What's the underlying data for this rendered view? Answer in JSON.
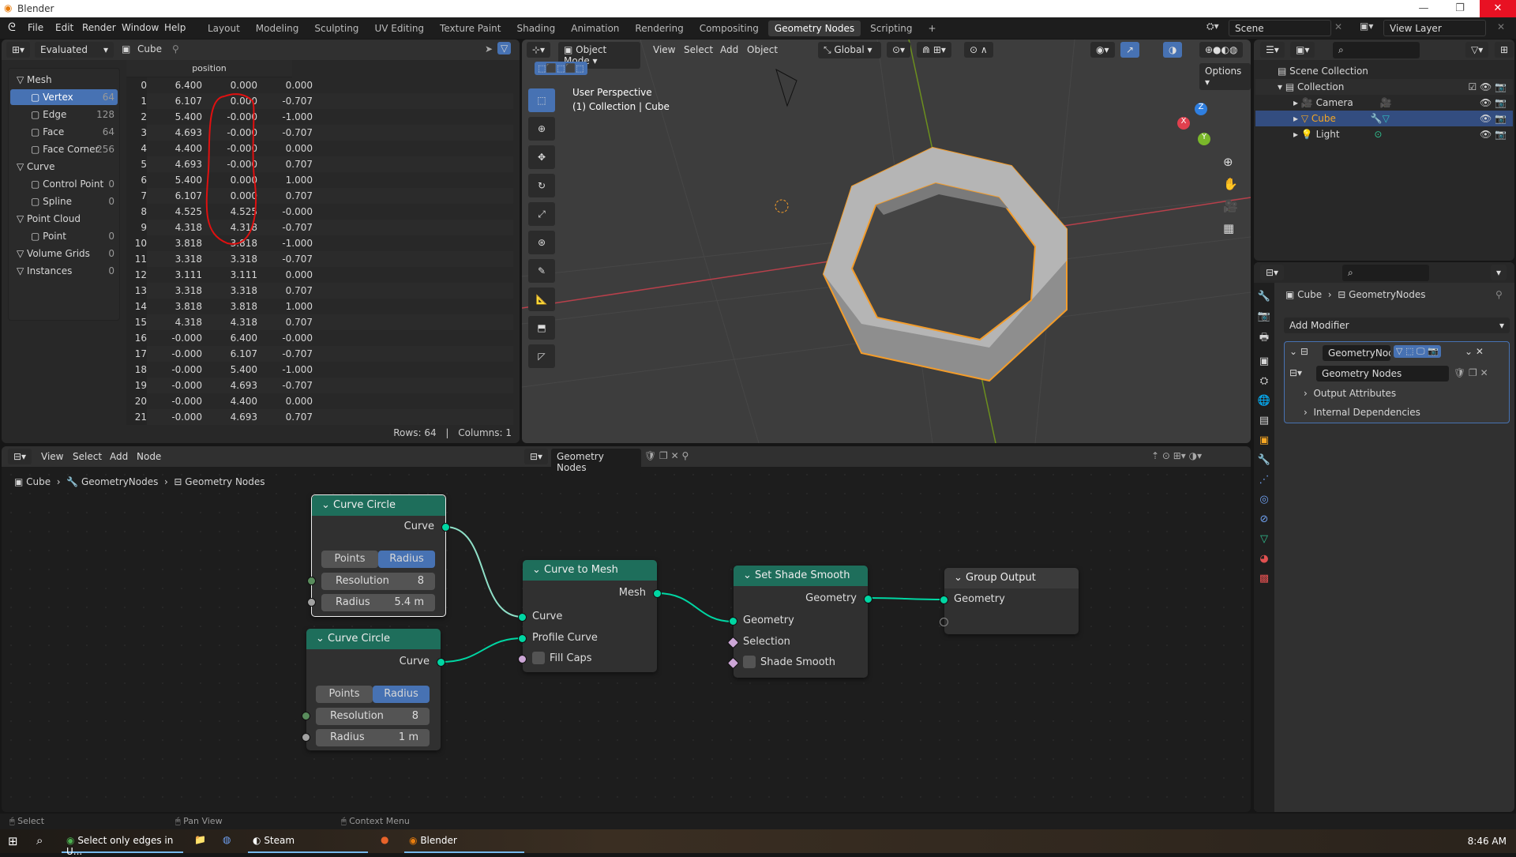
{
  "window": {
    "title": "Blender"
  },
  "menubar": {
    "items": [
      "File",
      "Edit",
      "Render",
      "Window",
      "Help"
    ],
    "workspaces": [
      "Layout",
      "Modeling",
      "Sculpting",
      "UV Editing",
      "Texture Paint",
      "Shading",
      "Animation",
      "Rendering",
      "Compositing",
      "Geometry Nodes",
      "Scripting"
    ],
    "active_workspace": "Geometry Nodes",
    "add_tab": "+",
    "scene": "Scene",
    "view_layer": "View Layer"
  },
  "spreadsheet": {
    "display_mode": "Evaluated",
    "object": "Cube",
    "tree": [
      {
        "label": "Mesh",
        "count": "",
        "level": 0
      },
      {
        "label": "Vertex",
        "count": "64",
        "level": 1,
        "selected": true
      },
      {
        "label": "Edge",
        "count": "128",
        "level": 1
      },
      {
        "label": "Face",
        "count": "64",
        "level": 1
      },
      {
        "label": "Face Corner",
        "count": "256",
        "level": 1
      },
      {
        "label": "Curve",
        "count": "",
        "level": 0
      },
      {
        "label": "Control Point",
        "count": "0",
        "level": 1
      },
      {
        "label": "Spline",
        "count": "0",
        "level": 1
      },
      {
        "label": "Point Cloud",
        "count": "",
        "level": 0
      },
      {
        "label": "Point",
        "count": "0",
        "level": 1
      },
      {
        "label": "Volume Grids",
        "count": "0",
        "level": 0
      },
      {
        "label": "Instances",
        "count": "0",
        "level": 0
      }
    ],
    "column_header": "position",
    "rows": [
      [
        "0",
        "6.400",
        "0.000",
        "0.000"
      ],
      [
        "1",
        "6.107",
        "0.000",
        "-0.707"
      ],
      [
        "2",
        "5.400",
        "-0.000",
        "-1.000"
      ],
      [
        "3",
        "4.693",
        "-0.000",
        "-0.707"
      ],
      [
        "4",
        "4.400",
        "-0.000",
        "0.000"
      ],
      [
        "5",
        "4.693",
        "-0.000",
        "0.707"
      ],
      [
        "6",
        "5.400",
        "0.000",
        "1.000"
      ],
      [
        "7",
        "6.107",
        "0.000",
        "0.707"
      ],
      [
        "8",
        "4.525",
        "4.525",
        "-0.000"
      ],
      [
        "9",
        "4.318",
        "4.318",
        "-0.707"
      ],
      [
        "10",
        "3.818",
        "3.818",
        "-1.000"
      ],
      [
        "11",
        "3.318",
        "3.318",
        "-0.707"
      ],
      [
        "12",
        "3.111",
        "3.111",
        "0.000"
      ],
      [
        "13",
        "3.318",
        "3.318",
        "0.707"
      ],
      [
        "14",
        "3.818",
        "3.818",
        "1.000"
      ],
      [
        "15",
        "4.318",
        "4.318",
        "0.707"
      ],
      [
        "16",
        "-0.000",
        "6.400",
        "-0.000"
      ],
      [
        "17",
        "-0.000",
        "6.107",
        "-0.707"
      ],
      [
        "18",
        "-0.000",
        "5.400",
        "-1.000"
      ],
      [
        "19",
        "-0.000",
        "4.693",
        "-0.707"
      ],
      [
        "20",
        "-0.000",
        "4.400",
        "0.000"
      ],
      [
        "21",
        "-0.000",
        "4.693",
        "0.707"
      ]
    ],
    "footer": {
      "rows": "Rows: 64",
      "sep": "|",
      "columns": "Columns: 1"
    }
  },
  "viewport": {
    "mode": "Object Mode",
    "menus": [
      "View",
      "Select",
      "Add",
      "Object"
    ],
    "orientation": "Global",
    "options": "Options",
    "overlay_title": "User Perspective",
    "overlay_sub": "(1) Collection | Cube",
    "gizmo": {
      "x": "X",
      "y": "Y",
      "z": "Z"
    }
  },
  "outliner": {
    "root": "Scene Collection",
    "collection": "Collection",
    "items": [
      {
        "label": "Camera",
        "color": "#e8983a"
      },
      {
        "label": "Cube",
        "color": "#f5a623",
        "selected": true
      },
      {
        "label": "Light",
        "color": "#e8983a"
      }
    ]
  },
  "properties": {
    "breadcrumb": [
      "Cube",
      "GeometryNodes"
    ],
    "add_modifier": "Add Modifier",
    "modifier_name": "GeometryNod...",
    "node_group": "Geometry Nodes",
    "sections": [
      "Output Attributes",
      "Internal Dependencies"
    ]
  },
  "node_editor": {
    "menus": [
      "View",
      "Select",
      "Add",
      "Node"
    ],
    "node_tree": "Geometry Nodes",
    "breadcrumb": [
      "Cube",
      "GeometryNodes",
      "Geometry Nodes"
    ],
    "nodes": {
      "cc1": {
        "title": "Curve Circle",
        "out": "Curve",
        "mode_a": "Points",
        "mode_b": "Radius",
        "res_label": "Resolution",
        "res": "8",
        "rad_label": "Radius",
        "rad": "5.4 m"
      },
      "cc2": {
        "title": "Curve Circle",
        "out": "Curve",
        "mode_a": "Points",
        "mode_b": "Radius",
        "res_label": "Resolution",
        "res": "8",
        "rad_label": "Radius",
        "rad": "1 m"
      },
      "c2m": {
        "title": "Curve to Mesh",
        "out": "Mesh",
        "in1": "Curve",
        "in2": "Profile Curve",
        "in3": "Fill Caps"
      },
      "sss": {
        "title": "Set Shade Smooth",
        "out": "Geometry",
        "in1": "Geometry",
        "in2": "Selection",
        "in3": "Shade Smooth"
      },
      "go": {
        "title": "Group Output",
        "in1": "Geometry"
      }
    },
    "colors": {
      "header": "#1e6e5b",
      "socket_geometry": "#00d6a3",
      "socket_int": "#598c5c",
      "socket_float": "#a1a1a1",
      "socket_bool": "#cca6d6"
    }
  },
  "statusbar": {
    "items": [
      "Select",
      "Pan View",
      "Context Menu"
    ]
  },
  "taskbar": {
    "apps": [
      "Select only edges in U...",
      "Steam",
      "Blender"
    ],
    "time": "8:46 AM"
  }
}
